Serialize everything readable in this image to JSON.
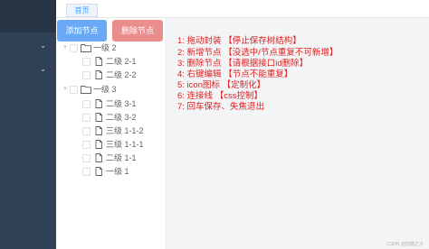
{
  "tab": {
    "label": "首页"
  },
  "buttons": {
    "add": "添加节点",
    "delete": "删除节点"
  },
  "tree": [
    {
      "label": "一级 2",
      "kind": "folder",
      "caret": "▾"
    },
    {
      "label": "二级 2-1",
      "kind": "file",
      "caret": ""
    },
    {
      "label": "二级 2-2",
      "kind": "file",
      "caret": ""
    },
    {
      "label": "一级 3",
      "kind": "folder",
      "caret": "▾"
    },
    {
      "label": "二级 3-1",
      "kind": "file",
      "caret": ""
    },
    {
      "label": "二级 3-2",
      "kind": "file",
      "caret": ""
    },
    {
      "label": "三级 1-1-2",
      "kind": "file",
      "caret": ""
    },
    {
      "label": "三级 1-1-1",
      "kind": "file",
      "caret": ""
    },
    {
      "label": "二级 1-1",
      "kind": "file",
      "caret": ""
    },
    {
      "label": "一级 1",
      "kind": "file",
      "caret": ""
    }
  ],
  "notes": [
    "1:  拖动封装 【停止保存树结构】",
    "2:  新增节点 【没选中/节点重复不可新增】",
    "3:  删除节点 【请根据接口id删除】",
    "4:  右键编辑 【节点不能重复】",
    "5:  icon图标 【定制化】",
    "6:  连接线  【css控制】",
    "7:  回车保存、失焦退出"
  ],
  "watermark": "CSDN @前端之子",
  "colors": {
    "sidebar": "#304156",
    "accent": "#409eff",
    "add_button": "#6aa9f5",
    "delete_button": "#ea8d8d",
    "note_text": "#e02020"
  },
  "icons": {
    "sidebar_expand": "chevron-down-icon",
    "folder": "folder-icon",
    "file": "document-icon",
    "tree_toggle": "caret-down-icon"
  }
}
